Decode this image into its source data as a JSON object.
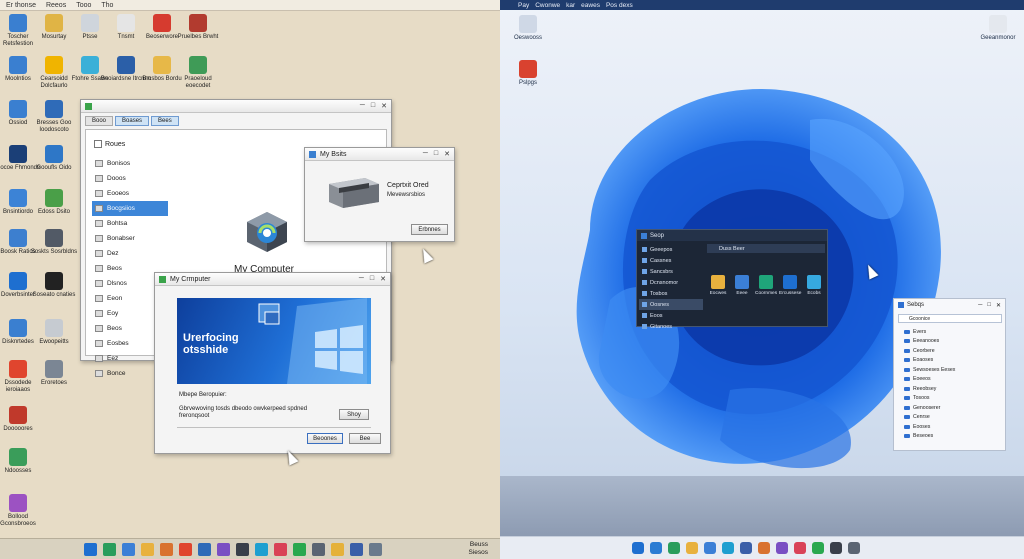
{
  "left": {
    "menubar": [
      "Er thonse",
      "Reeos",
      "Tooo",
      "Tho"
    ],
    "desktop_icons": [
      {
        "label": "Toscher Retsfestion",
        "icon": "computer-icon",
        "color": "#3a7fd0"
      },
      {
        "label": "Mosurtay",
        "icon": "folder-icon",
        "color": "#e0b445"
      },
      {
        "label": "Ptsse",
        "icon": "document-icon",
        "color": "#cfd5dc"
      },
      {
        "label": "Tnsmt",
        "icon": "globe-icon",
        "color": "#e5e5e5"
      },
      {
        "label": "Beoserwore",
        "icon": "record-icon",
        "color": "#d63b2f"
      },
      {
        "label": "Pruelbes Brwht",
        "icon": "media-icon",
        "color": "#b23b2f"
      },
      {
        "label": "Moolntios",
        "icon": "monitor-icon",
        "color": "#3a7fd0"
      },
      {
        "label": "Cearsoidd Dolcfaurlo",
        "icon": "chip-icon",
        "color": "#f0b400"
      },
      {
        "label": "Ftohre Ssaws",
        "icon": "image-icon",
        "color": "#3bb0d8"
      },
      {
        "label": "Beoiardsne Itrcnno",
        "icon": "app-icon",
        "color": "#2b5fa8"
      },
      {
        "label": "Bmsbos Bordu",
        "icon": "folder-icon",
        "color": "#e7b848"
      },
      {
        "label": "Praoeloud eoecodet",
        "icon": "image-icon",
        "color": "#3f9b57"
      },
      {
        "label": "Ossiod",
        "icon": "monitor-icon",
        "color": "#3a7fd0"
      },
      {
        "label": "Bresses Goo Ioodoscoto",
        "icon": "app-icon",
        "color": "#2f6bb8"
      },
      {
        "label": "Docoe Fhmonds",
        "icon": "tool-icon",
        "color": "#1b3f77"
      },
      {
        "label": "Gooufls Oido",
        "icon": "app-icon",
        "color": "#2e77c7"
      },
      {
        "label": "Bnsintiordo",
        "icon": "computer-icon",
        "color": "#3c83d6"
      },
      {
        "label": "Edoss Dsito",
        "icon": "image-icon",
        "color": "#4a9f48"
      },
      {
        "label": "Boosk Ratios",
        "icon": "globe-icon",
        "color": "#3d7fcf"
      },
      {
        "label": "Soskts Sosrbldns",
        "icon": "app-icon",
        "color": "#525a66"
      },
      {
        "label": "Doverbsinter",
        "icon": "globe-icon",
        "color": "#1e6fd0"
      },
      {
        "label": "Soseato cnaties",
        "icon": "app-icon",
        "color": "#222"
      },
      {
        "label": "Disknrtedes",
        "icon": "monitor-icon",
        "color": "#3a7fd0"
      },
      {
        "label": "Ewoopeitts",
        "icon": "document-icon",
        "color": "#c6cbd1"
      },
      {
        "label": "Dssodede ieroiaaos",
        "icon": "globe-icon",
        "color": "#e0452e"
      },
      {
        "label": "Eroretoes",
        "icon": "app-icon",
        "color": "#7b8694"
      },
      {
        "label": "Dooooores",
        "icon": "media-icon",
        "color": "#c0392b"
      },
      {
        "label": "Ndoosses",
        "icon": "app-icon",
        "color": "#3a9d5a"
      },
      {
        "label": "Bollood Gconsbroeos",
        "icon": "globe-icon",
        "color": "#9c52c2"
      }
    ],
    "explorer": {
      "tabs": [
        "Booo",
        "Boases",
        "Bees"
      ],
      "tree": [
        "Bonisos",
        "Dooos",
        "Eooeos",
        "Bocgsiios",
        "Bohtsa",
        "Bonabser",
        "Dez",
        "Beos",
        "Dlsnos",
        "Eeon",
        "Eoy",
        "Beos",
        "Eosbes",
        "Eez",
        "Bonce"
      ],
      "selected_index": 3,
      "content_title": "Roues",
      "content_label": "My Computer"
    },
    "mybox": {
      "title": "My Bsits",
      "line1": "Ceprtxit Ored",
      "line2": "Mevewsrsbios",
      "button": "Erbnnes"
    },
    "mycomputer": {
      "title": "My Crmputer",
      "banner_text": "Urerfocing otsshide",
      "caption": "Mbepe Beropuier:",
      "message": "Gbrvewoving tosds dbeodo owvkerpeed spdned freronqsoot",
      "side_button": "Shoy",
      "ok_button": "Beoones",
      "cancel_button": "Bee"
    },
    "taskbar": {
      "clock_line1": "Beuss",
      "clock_line2": "Siesos"
    }
  },
  "right": {
    "topbar": [
      "Pay",
      "Cwonwe",
      "kar",
      "eawes",
      "Pos dexs"
    ],
    "desktop_icons": [
      {
        "label": "Oeswooss",
        "icon": "recycle-bin-icon",
        "color": "#cfd8e6"
      },
      {
        "label": "Pslpgs",
        "icon": "record-icon",
        "color": "#d9422f"
      },
      {
        "label": "Geeanmonor",
        "icon": "recycle-bin-icon",
        "color": "#e4e8ee"
      }
    ],
    "darkwin": {
      "title": "Seop",
      "header": "Duss Beer",
      "sidebar": [
        "Geeepos",
        "Cassnes",
        "Sancsbrs",
        "Dcnsnomor",
        "Tosbos",
        "Oosnes",
        "Eoos",
        "Gitanoes"
      ],
      "selected_index": 5,
      "apps": [
        {
          "label": "Eocwes",
          "icon": "folder-icon",
          "color": "#e8b13e"
        },
        {
          "label": "Eeee",
          "icon": "app-icon",
          "color": "#3b7fd6"
        },
        {
          "label": "Coornmes",
          "icon": "app-icon",
          "color": "#1fa57a"
        },
        {
          "label": "Ercussese",
          "icon": "globe-icon",
          "color": "#1e6fd0"
        },
        {
          "label": "Ecobs",
          "icon": "app-icon",
          "color": "#36a9e0"
        }
      ]
    },
    "settings": {
      "title": "Sebqs",
      "search_placeholder": "Gcoonice",
      "items": [
        "Evers",
        "Eeeanooes",
        "Ceorbere",
        "Eoaoses",
        "Sewsoeses Eesex",
        "Eoeeos",
        "Reeobsey",
        "Tosoos",
        "Genooserer",
        "Cenrse",
        "Eooses",
        "Beseoes"
      ]
    },
    "taskbar_icons": [
      {
        "icon": "start-icon",
        "color": "#1e6fd0"
      },
      {
        "icon": "search-icon",
        "color": "#2b7cd3"
      },
      {
        "icon": "files-icon",
        "color": "#2a9d5c"
      },
      {
        "icon": "folder-icon",
        "color": "#e8b13e"
      },
      {
        "icon": "mail-icon",
        "color": "#3b7fd6"
      },
      {
        "icon": "edge-icon",
        "color": "#1e9fd0"
      },
      {
        "icon": "store-icon",
        "color": "#3b5fa8"
      },
      {
        "icon": "photos-icon",
        "color": "#d9722f"
      },
      {
        "icon": "settings-icon",
        "color": "#7a4fc3"
      },
      {
        "icon": "media-icon",
        "color": "#d94257"
      },
      {
        "icon": "terminal-icon",
        "color": "#2aa84f"
      },
      {
        "icon": "game-icon",
        "color": "#3a3f4a"
      },
      {
        "icon": "app-icon",
        "color": "#5a6472"
      }
    ]
  }
}
